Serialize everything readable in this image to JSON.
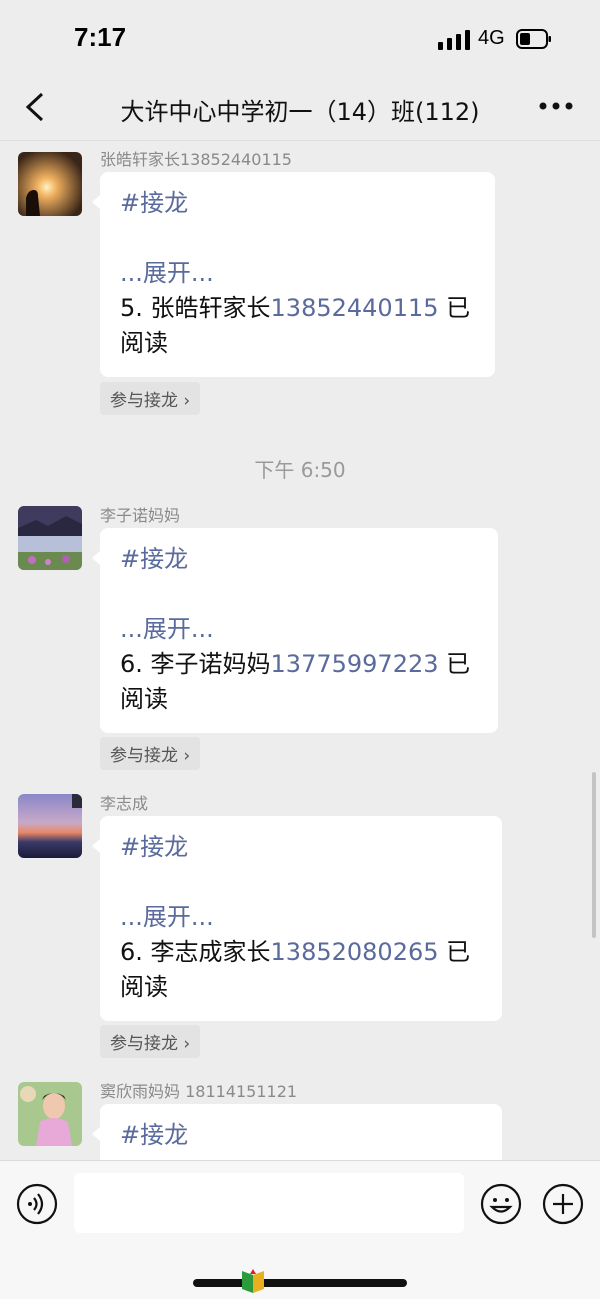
{
  "status_bar": {
    "time": "7:17",
    "network": "4G"
  },
  "header": {
    "title": "大许中心中学初一（14）班(112)"
  },
  "timestamp": "下午 6:50",
  "messages": [
    {
      "sender": "张皓轩家长13852440115",
      "lines": [
        "#接龙",
        "",
        "...展开...",
        "5. 张皓轩家长",
        "13852440115",
        " 已",
        "阅读"
      ],
      "join_label": "参与接龙"
    },
    {
      "sender": "李子诺妈妈",
      "lines": [
        "#接龙",
        "",
        "...展开...",
        "6. 李子诺妈妈",
        "13775997223",
        " 已",
        "阅读"
      ],
      "join_label": "参与接龙"
    },
    {
      "sender": "李志成",
      "lines": [
        "#接龙",
        "",
        "...展开...",
        "6. 李志成家长",
        "13852080265",
        " 已",
        "阅读"
      ],
      "join_label": "参与接龙"
    },
    {
      "sender": "窦欣雨妈妈 18114151121",
      "lines": [
        "#接龙"
      ]
    }
  ],
  "input": {
    "placeholder": ""
  },
  "icons": {
    "back": "chevron-left-icon",
    "more": "more-dots-icon",
    "voice": "voice-icon",
    "emoji": "emoji-icon",
    "plus": "plus-icon"
  },
  "colors": {
    "background": "#ededed",
    "bubble": "#ffffff",
    "link": "#5a6a9c"
  }
}
